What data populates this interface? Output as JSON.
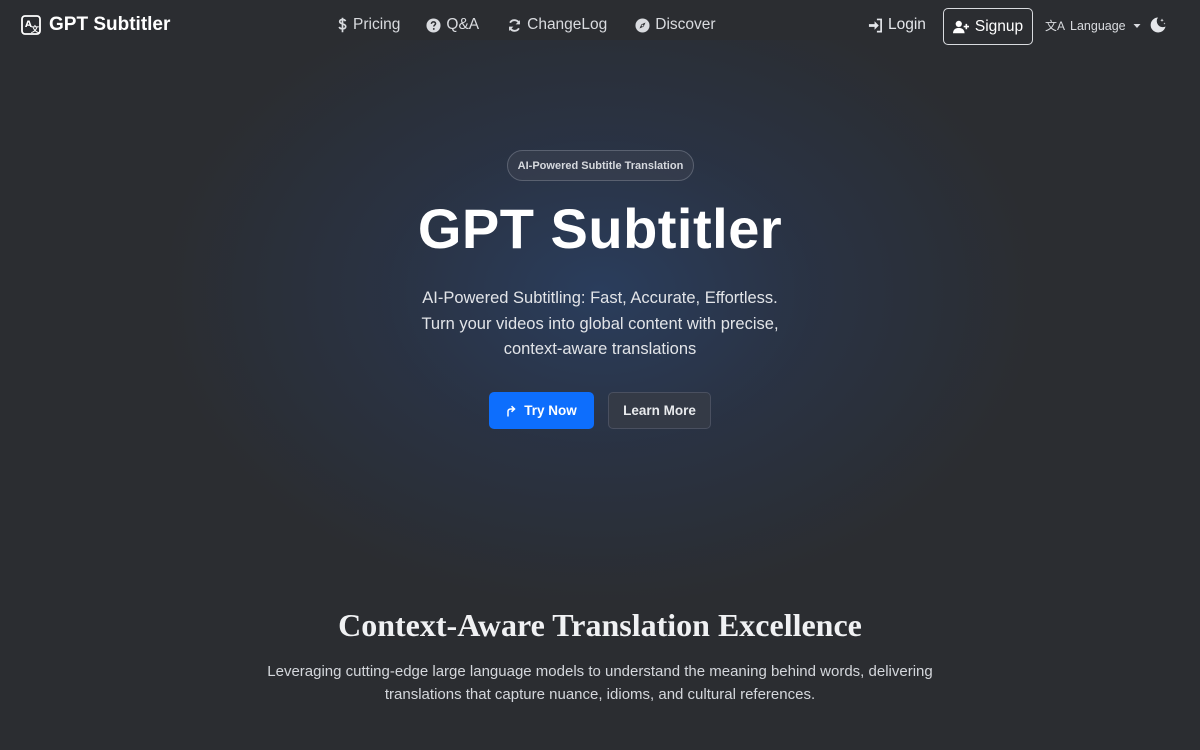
{
  "brand": {
    "name": "GPT Subtitler"
  },
  "nav": {
    "links": [
      {
        "label": "Pricing",
        "icon": "dollar-icon"
      },
      {
        "label": "Q&A",
        "icon": "question-circle-icon"
      },
      {
        "label": "ChangeLog",
        "icon": "refresh-icon"
      },
      {
        "label": "Discover",
        "icon": "compass-icon"
      }
    ],
    "login": "Login",
    "signup": "Signup",
    "language": "Language"
  },
  "hero": {
    "badge": "AI-Powered Subtitle Translation",
    "title": "GPT Subtitler",
    "subtitle_lines": [
      "AI-Powered Subtitling: Fast, Accurate, Effortless.",
      "Turn your videos into global content with precise,",
      "context-aware translations"
    ],
    "try_now": "Try Now",
    "learn_more": "Learn More"
  },
  "section": {
    "title": "Context-Aware Translation Excellence",
    "description_lines": [
      "Leveraging cutting-edge large language models to understand the meaning behind words, delivering",
      "translations that capture nuance, idioms, and cultural references."
    ]
  },
  "colors": {
    "background": "#2b2d31",
    "primary": "#0d6efd",
    "text": "#ffffff"
  }
}
